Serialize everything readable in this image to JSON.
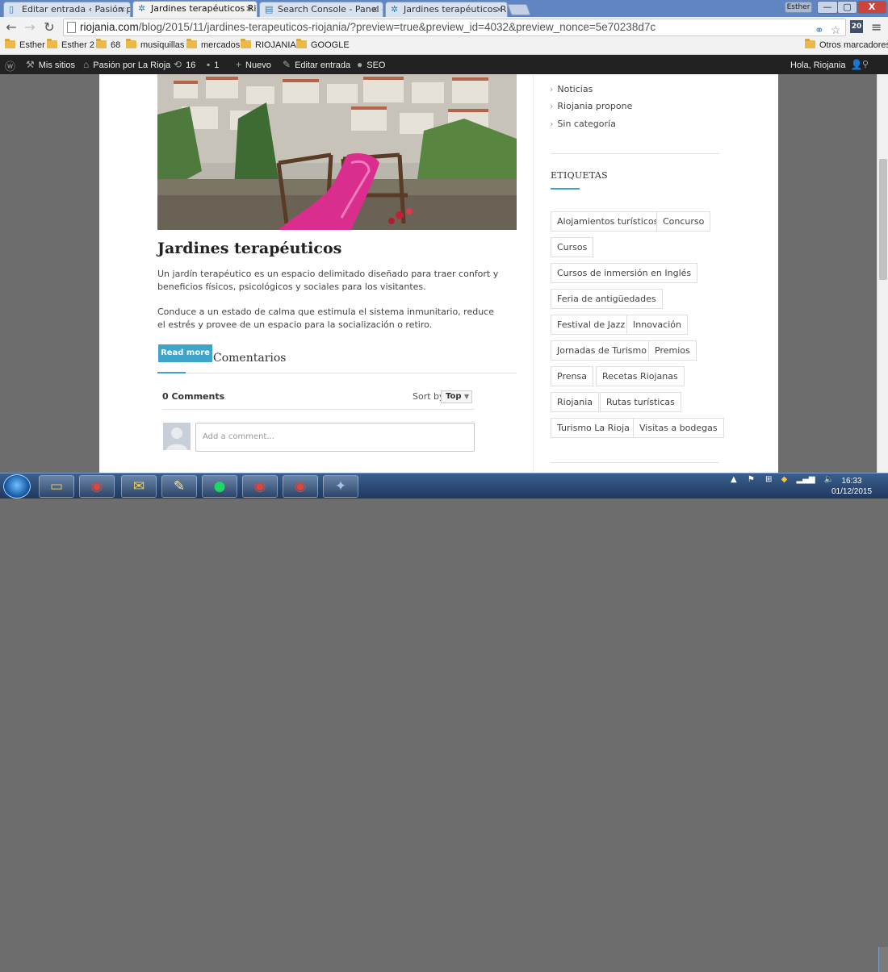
{
  "tabs": [
    {
      "label": "Editar entrada ‹ Pasión po",
      "active": false,
      "icon": "page-icon"
    },
    {
      "label": "Jardines terapéuticos Rioj",
      "active": true,
      "icon": "snowflake-icon"
    },
    {
      "label": "Search Console - Panel de",
      "active": false,
      "icon": "search-console-icon"
    },
    {
      "label": "Jardines terapéuticos Rioj",
      "active": false,
      "icon": "snowflake-icon"
    }
  ],
  "window": {
    "user": "Esther",
    "min": "—",
    "max": "▢",
    "close": "X"
  },
  "toolbar": {
    "url_host": "riojania.com",
    "url_rest": "/blog/2015/11/jardines-terapeuticos-riojania/?preview=true&preview_id=4032&preview_nonce=5e70238d7c",
    "ext_badge": "20"
  },
  "bookmarks": {
    "items": [
      "Esther",
      "Esther 2",
      "68",
      "musiquillas",
      "mercados",
      "RIOJANIA",
      "GOOGLE"
    ],
    "other": "Otros marcadores"
  },
  "adminbar": {
    "my_sites": "Mis sitios",
    "site": "Pasión por La Rioja",
    "updates": "16",
    "comments": "1",
    "new": "Nuevo",
    "edit": "Editar entrada",
    "seo": "SEO",
    "greeting": "Hola, Riojania"
  },
  "post": {
    "title": "Jardines terapéuticos",
    "p1": "Un jardín terapéutico es un espacio delimitado diseñado para traer confort y beneficios físicos, psicológicos y sociales para los visitantes.",
    "p2": "Conduce a un estado de calma que estimula el sistema inmunitario, reduce el estrés y provee de un espacio para la socialización o retiro.",
    "read_more": "Read more"
  },
  "comments": {
    "heading": "Comentarios",
    "count": "0 Comments",
    "sort_label": "Sort by",
    "sort_value": "Top",
    "placeholder": "Add a comment..."
  },
  "sidebar": {
    "categories": [
      "Noticias",
      "Riojania propone",
      "Sin categoría"
    ],
    "tags_title": "ETIQUETAS",
    "tags": [
      "Alojamientos turísticos",
      "Concurso",
      "Cursos",
      "Cursos de inmersión en Inglés",
      "Feria de antigüedades",
      "Festival de Jazz",
      "Innovación",
      "Jornadas de Turismo",
      "Premios",
      "Prensa",
      "Recetas Riojanas",
      "Riojania",
      "Rutas turísticas",
      "Turismo La Rioja",
      "Visitas a bodegas"
    ]
  },
  "taskbar": {
    "time": "16:33",
    "date": "01/12/2015"
  },
  "colors": {
    "accent": "#3fa4c9",
    "adminbar": "#222222",
    "tabstrip": "#5f86c2"
  }
}
